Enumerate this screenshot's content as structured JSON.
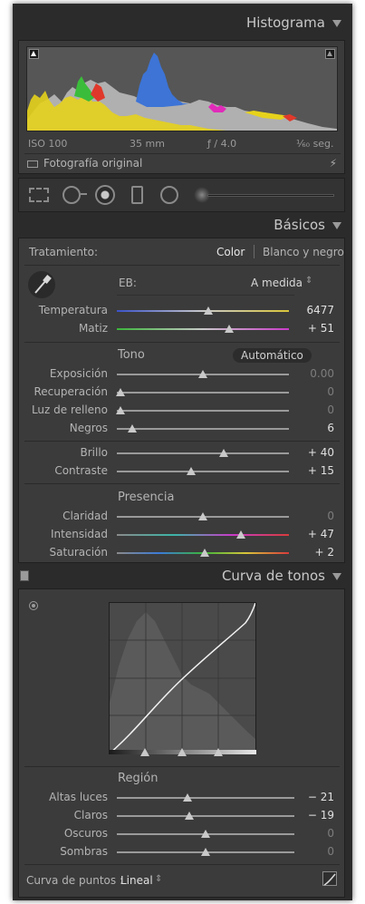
{
  "histogram": {
    "title": "Histograma",
    "iso": "ISO 100",
    "focal": "35 mm",
    "aperture": "ƒ / 4.0",
    "shutter": "¹⁄₆₀ seg.",
    "original_photo": "Fotografía original"
  },
  "basicos": {
    "title": "Básicos",
    "treatment_label": "Tratamiento:",
    "treatment_color": "Color",
    "treatment_bw": "Blanco y negro",
    "wb_label": "EB:",
    "wb_value": "A medida",
    "tone_label": "Tono",
    "auto_label": "Automático",
    "presence_label": "Presencia",
    "sliders": {
      "temperatura": {
        "label": "Temperatura",
        "value": "6477",
        "level": 0.53
      },
      "matiz": {
        "label": "Matiz",
        "value": "+ 51",
        "level": 0.65
      },
      "exposicion": {
        "label": "Exposición",
        "value": "0.00",
        "level": 0.5
      },
      "recuperacion": {
        "label": "Recuperación",
        "value": "0",
        "level": 0.02
      },
      "luz": {
        "label": "Luz de relleno",
        "value": "0",
        "level": 0.02
      },
      "negros": {
        "label": "Negros",
        "value": "6",
        "level": 0.09
      },
      "brillo": {
        "label": "Brillo",
        "value": "+ 40",
        "level": 0.62
      },
      "contraste": {
        "label": "Contraste",
        "value": "+ 15",
        "level": 0.43
      },
      "claridad": {
        "label": "Claridad",
        "value": "0",
        "level": 0.5
      },
      "intensidad": {
        "label": "Intensidad",
        "value": "+ 47",
        "level": 0.72
      },
      "saturacion": {
        "label": "Saturación",
        "value": "+ 2",
        "level": 0.51
      }
    }
  },
  "curve": {
    "title": "Curva de tonos",
    "region_label": "Región",
    "sliders": {
      "altas": {
        "label": "Altas luces",
        "value": "− 21",
        "level": 0.4
      },
      "claros": {
        "label": "Claros",
        "value": "− 19",
        "level": 0.41
      },
      "oscuros": {
        "label": "Oscuros",
        "value": "0",
        "level": 0.5
      },
      "sombras": {
        "label": "Sombras",
        "value": "0",
        "level": 0.5
      }
    },
    "point_curve_label": "Curva de puntos :",
    "point_curve_value": "Lineal"
  },
  "colors": {
    "panel_bg": "#3b3b3b",
    "header_bg": "#2b2b2b",
    "histogram_blue": "#3d74d6",
    "histogram_yellow": "#e6d21c",
    "histogram_green": "#3bbd3b",
    "histogram_magenta": "#e02bb9",
    "histogram_red": "#e0392b"
  }
}
